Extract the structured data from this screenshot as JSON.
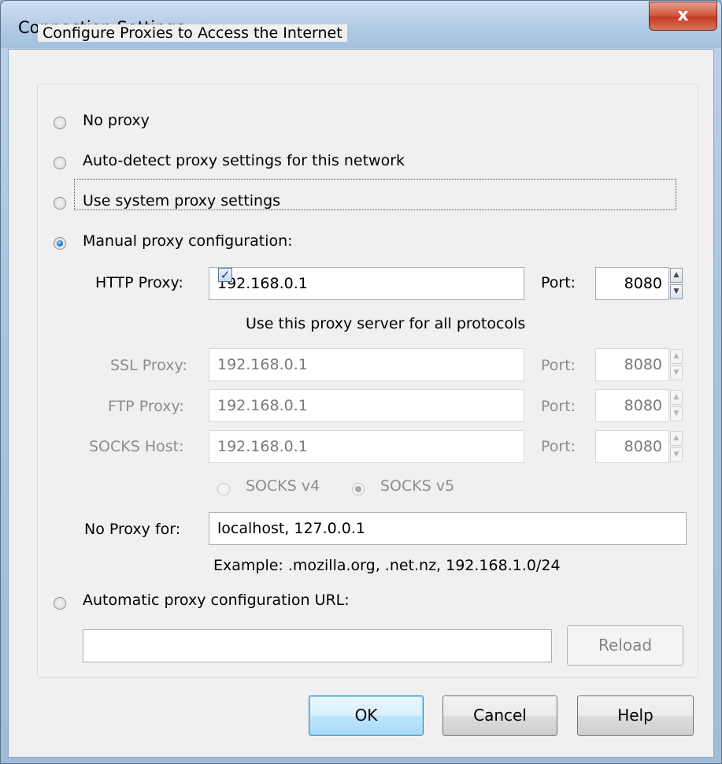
{
  "window": {
    "title": "Connection Settings",
    "close_glyph": "x"
  },
  "group": {
    "legend": "Configure Proxies to Access the Internet"
  },
  "options": {
    "no_proxy": "No proxy",
    "auto_detect": "Auto-detect proxy settings for this network",
    "system": "Use system proxy settings",
    "manual": "Manual proxy configuration:",
    "auto_url": "Automatic proxy configuration URL:",
    "selected": "manual"
  },
  "http": {
    "label": "HTTP Proxy:",
    "value": "192.168.0.1",
    "port_label": "Port:",
    "port": "8080"
  },
  "share_all": {
    "label": "Use this proxy server for all protocols",
    "checked": true
  },
  "ssl": {
    "label": "SSL Proxy:",
    "value": "192.168.0.1",
    "port_label": "Port:",
    "port": "8080"
  },
  "ftp": {
    "label": "FTP Proxy:",
    "value": "192.168.0.1",
    "port_label": "Port:",
    "port": "8080"
  },
  "socks": {
    "label": "SOCKS Host:",
    "value": "192.168.0.1",
    "port_label": "Port:",
    "port": "8080",
    "v4": "SOCKS v4",
    "v5": "SOCKS v5",
    "selected": "v5"
  },
  "no_proxy_for": {
    "label": "No Proxy for:",
    "value": "localhost, 127.0.0.1",
    "example": "Example: .mozilla.org, .net.nz, 192.168.1.0/24"
  },
  "auto_url": {
    "value": "",
    "reload_label": "Reload"
  },
  "buttons": {
    "ok": "OK",
    "cancel": "Cancel",
    "help": "Help"
  },
  "colors": {
    "accent": "#3c7fb1",
    "close": "#c33d22",
    "title_bar": "#b2cbe5"
  }
}
